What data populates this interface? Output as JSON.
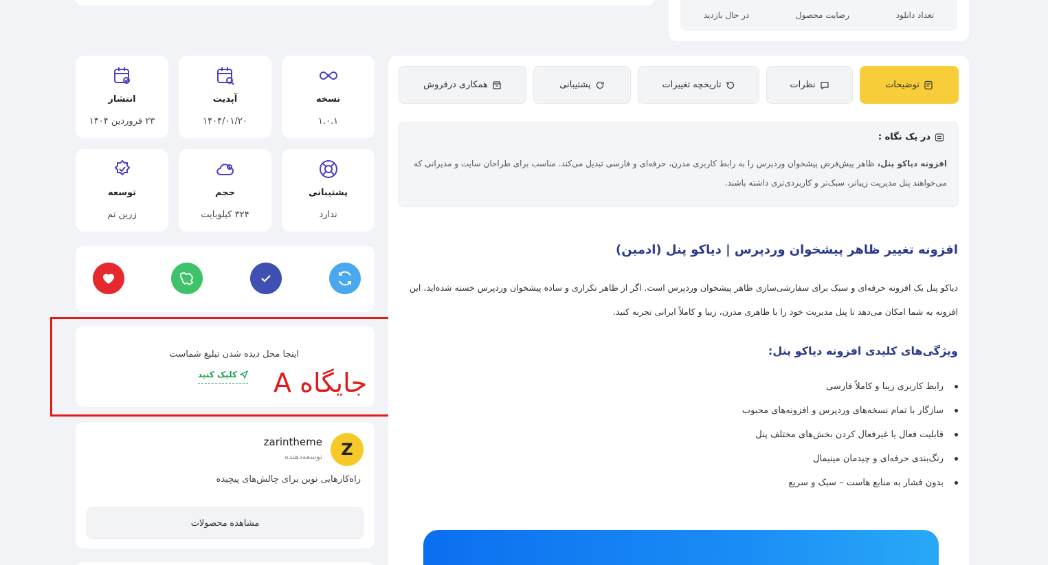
{
  "top_stats": {
    "items": [
      "تعداد دانلود",
      "رضایت محصول",
      "در حال بازدید"
    ]
  },
  "info_cards": {
    "version": {
      "title": "نسخه",
      "value": "۱.۰.۱",
      "icon": "infinity-icon"
    },
    "update": {
      "title": "آپدیت",
      "value": "۱۴۰۴/۰۱/۲۰",
      "icon": "calendar-search-icon"
    },
    "publish": {
      "title": "انتشار",
      "value": "۲۳ فروردین ۱۴۰۴",
      "icon": "calendar-check-icon"
    },
    "support": {
      "title": "پشتیبانی",
      "value": "ندارد",
      "icon": "lifebuoy-icon"
    },
    "size": {
      "title": "حجم",
      "value": "۳۲۴ کیلوبایت",
      "icon": "cloud-icon"
    },
    "developer": {
      "title": "توسعه",
      "value": "زرین تم",
      "icon": "verified-badge-icon"
    }
  },
  "actions": {
    "colors": {
      "update": "#4aa8ef",
      "verified": "#3f4fb2",
      "iran": "#3ec36a",
      "favorite": "#e5292f"
    }
  },
  "ad": {
    "text": "اینجا محل دیده شدن تبلیغ شماست",
    "link": "کلیک کنید",
    "marker": "A جایگاه"
  },
  "developer_card": {
    "avatar_letter": "Z",
    "name": "zarintheme",
    "role": "توسعه‌دهنده",
    "description": "راه‌کارهایی نوین برای چالش‌های پیچیده",
    "button": "مشاهده محصولات"
  },
  "tabs": [
    {
      "label": "توضیحات",
      "icon": "document-icon"
    },
    {
      "label": "نظرات",
      "icon": "comment-icon"
    },
    {
      "label": "تاریخچه تغییرات",
      "icon": "history-icon"
    },
    {
      "label": "پشتیبانی",
      "icon": "refresh-icon"
    },
    {
      "label": "همکاری درفروش",
      "icon": "shop-icon"
    }
  ],
  "glance": {
    "title": "در یک نگاه :",
    "text_bold": "افزونه دیاکو پنل،",
    "text": " ظاهر پیش‌فرض پیشخوان وردپرس را به رابط کاربری مدرن، حرفه‌ای و فارسی تبدیل می‌کند. مناسب برای طراحان سایت و مدیرانی که می‌خواهند پنل مدیریت زیباتر، سبک‌تر و کاربردی‌تری داشته باشند."
  },
  "content": {
    "title": "افزونه تغییر ظاهر پیشخوان وردپرس | دیاکو پنل (ادمین)",
    "intro": "دیاکو پنل یک افزونه حرفه‌ای و سبک برای سفارشی‌سازی ظاهر پیشخوان وردپرس است. اگر از ظاهر تکراری و ساده پیشخوان وردپرس خسته شده‌اید، این افزونه به شما امکان می‌دهد تا پنل مدیریت خود را با ظاهری مدرن، زیبا و کاملاً ایرانی تجربه کنید.",
    "features_title": "ویژگی‌های کلیدی افزونه دیاکو پنل:",
    "features": [
      "رابط کاربری زیبا و کاملاً فارسی",
      "سازگار با تمام نسخه‌های وردپرس و افزونه‌های محبوب",
      "قابلیت فعال یا غیرفعال کردن بخش‌های مختلف پنل",
      "رنگ‌بندی حرفه‌ای و چیدمان مینیمال",
      "بدون فشار به منابع هاست – سبک و سریع"
    ]
  }
}
